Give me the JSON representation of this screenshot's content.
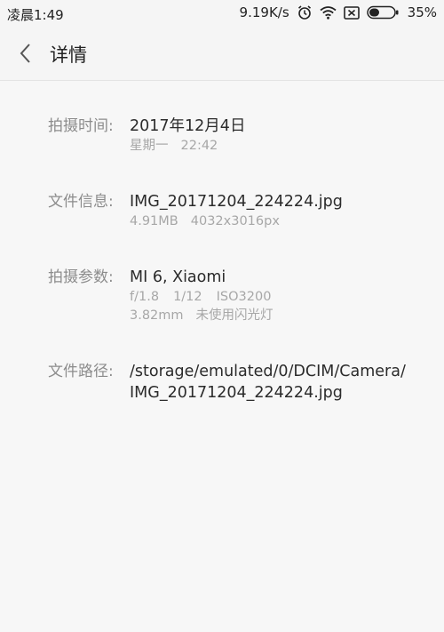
{
  "status_bar": {
    "time": "凌晨1:49",
    "speed": "9.19K/s",
    "battery": "35%",
    "icons": [
      "alarm-icon",
      "wifi-icon",
      "sim-icon",
      "battery-icon"
    ]
  },
  "header": {
    "title": "详情"
  },
  "details": {
    "shot_time": {
      "label": "拍摄时间:",
      "date": "2017年12月4日",
      "weekday": "星期一",
      "time": "22:42"
    },
    "file_info": {
      "label": "文件信息:",
      "name": "IMG_20171204_224224.jpg",
      "size": "4.91MB",
      "resolution": "4032x3016px"
    },
    "shot_params": {
      "label": "拍摄参数:",
      "device": "MI 6, Xiaomi",
      "aperture": "f/1.8",
      "shutter": "1/12",
      "iso": "ISO3200",
      "focal_length": "3.82mm",
      "flash": "未使用闪光灯"
    },
    "file_path": {
      "label": "文件路径:",
      "line1": "/storage/emulated/0/DCIM/Camera/",
      "line2": "IMG_20171204_224224.jpg"
    }
  }
}
